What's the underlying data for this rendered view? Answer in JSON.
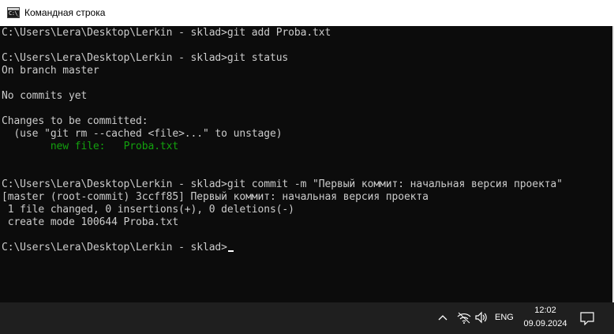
{
  "window": {
    "title": "Командная строка",
    "icon_text": "C:\\_"
  },
  "console": {
    "lines": [
      "C:\\Users\\Lera\\Desktop\\Lerkin - sklad>git add Proba.txt",
      "",
      "C:\\Users\\Lera\\Desktop\\Lerkin - sklad>git status",
      "On branch master",
      "",
      "No commits yet",
      "",
      "Changes to be committed:",
      "  (use \"git rm --cached <file>...\" to unstage)",
      "",
      "",
      "",
      "C:\\Users\\Lera\\Desktop\\Lerkin - sklad>git commit -m \"Первый коммит: начальная версия проекта\"",
      "[master (root-commit) 3ccff85] Первый коммит: начальная версия проекта",
      " 1 file changed, 0 insertions(+), 0 deletions(-)",
      " create mode 100644 Proba.txt",
      "",
      "C:\\Users\\Lera\\Desktop\\Lerkin - sklad>"
    ],
    "staged_file": {
      "indent": "        ",
      "label": "new file:",
      "gap": "   ",
      "name": "Proba.txt"
    },
    "colors": {
      "text": "#cccccc",
      "staged": "#13a10e",
      "background": "#0c0c0c"
    }
  },
  "taskbar": {
    "tray": {
      "overflow_icon": "chevron-up-icon",
      "network_icon": "wifi-icon",
      "volume_icon": "speaker-icon",
      "notifications_icon": "notification-icon"
    },
    "language": "ENG",
    "time": "12:02",
    "date": "09.09.2024"
  }
}
